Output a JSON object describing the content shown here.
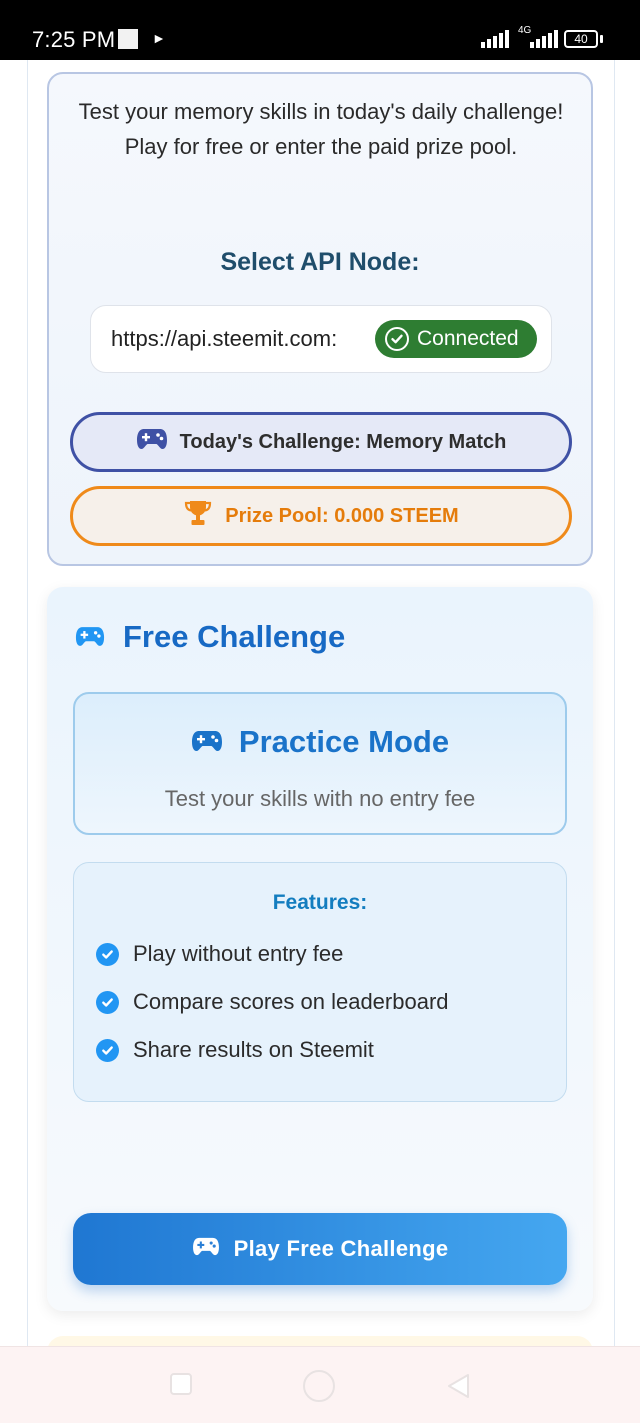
{
  "status_bar": {
    "time": "7:25 PM",
    "network_label": "4G",
    "battery": "40"
  },
  "info_card": {
    "intro_text": "Test your memory skills in today's daily challenge! Play for free or enter the paid prize pool.",
    "api_title": "Select API Node:",
    "api_url": "https://api.steemit.com:",
    "connection_status": "Connected",
    "challenge_label": "Today's Challenge: Memory Match",
    "prize_pool_label": "Prize Pool: 0.000 STEEM"
  },
  "free_challenge": {
    "heading": "Free Challenge",
    "mode_title": "Practice Mode",
    "mode_description": "Test your skills with no entry fee",
    "features_title": "Features:",
    "features": [
      "Play without entry fee",
      "Compare scores on leaderboard",
      "Share results on Steemit"
    ],
    "play_button_label": "Play Free Challenge"
  },
  "colors": {
    "primary_blue": "#1769c4",
    "connected_green": "#2e7d32",
    "challenge_border": "#3f51a5",
    "prize_orange": "#ef8a1a",
    "check_blue": "#2196f3"
  },
  "icons": {
    "connected": "check-circle-icon",
    "challenge": "gamepad-icon",
    "prize": "trophy-icon",
    "feature": "check-circle-icon",
    "play_button": "gamepad-icon"
  }
}
